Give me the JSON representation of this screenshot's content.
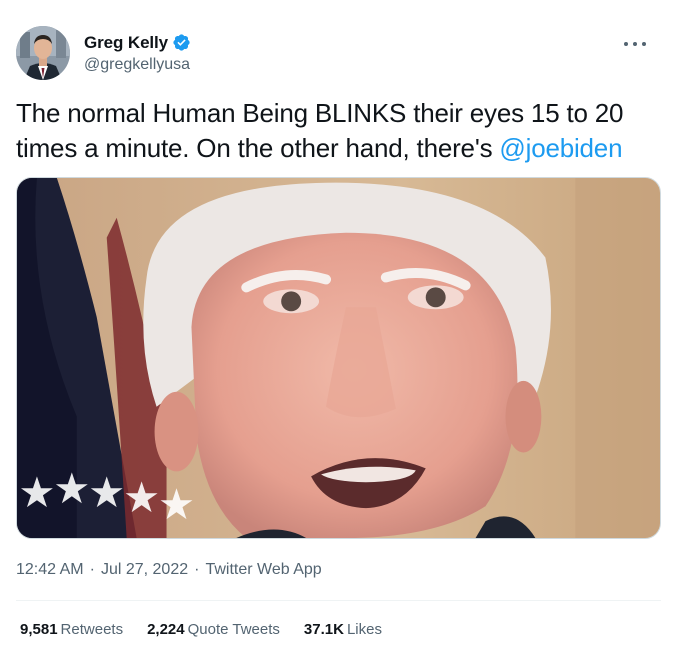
{
  "author": {
    "display_name": "Greg Kelly",
    "handle": "@gregkellyusa",
    "verified": true,
    "verified_color": "#1d9bf0"
  },
  "tweet": {
    "text_before": "The normal Human Being BLINKS their eyes 15 to 20 times a minute. On the other hand, there's ",
    "mention": "@joebiden",
    "mention_color": "#1d9bf0"
  },
  "media": {
    "icon": "video-still-image"
  },
  "meta": {
    "time": "12:42 AM",
    "separator": "·",
    "date": "Jul 27, 2022",
    "source": "Twitter Web App"
  },
  "stats": [
    {
      "value": "9,581",
      "label": "Retweets"
    },
    {
      "value": "2,224",
      "label": "Quote Tweets"
    },
    {
      "value": "37.1K",
      "label": "Likes"
    }
  ],
  "colors": {
    "text_primary": "#0f1419",
    "text_secondary": "#536471",
    "accent": "#1d9bf0"
  }
}
